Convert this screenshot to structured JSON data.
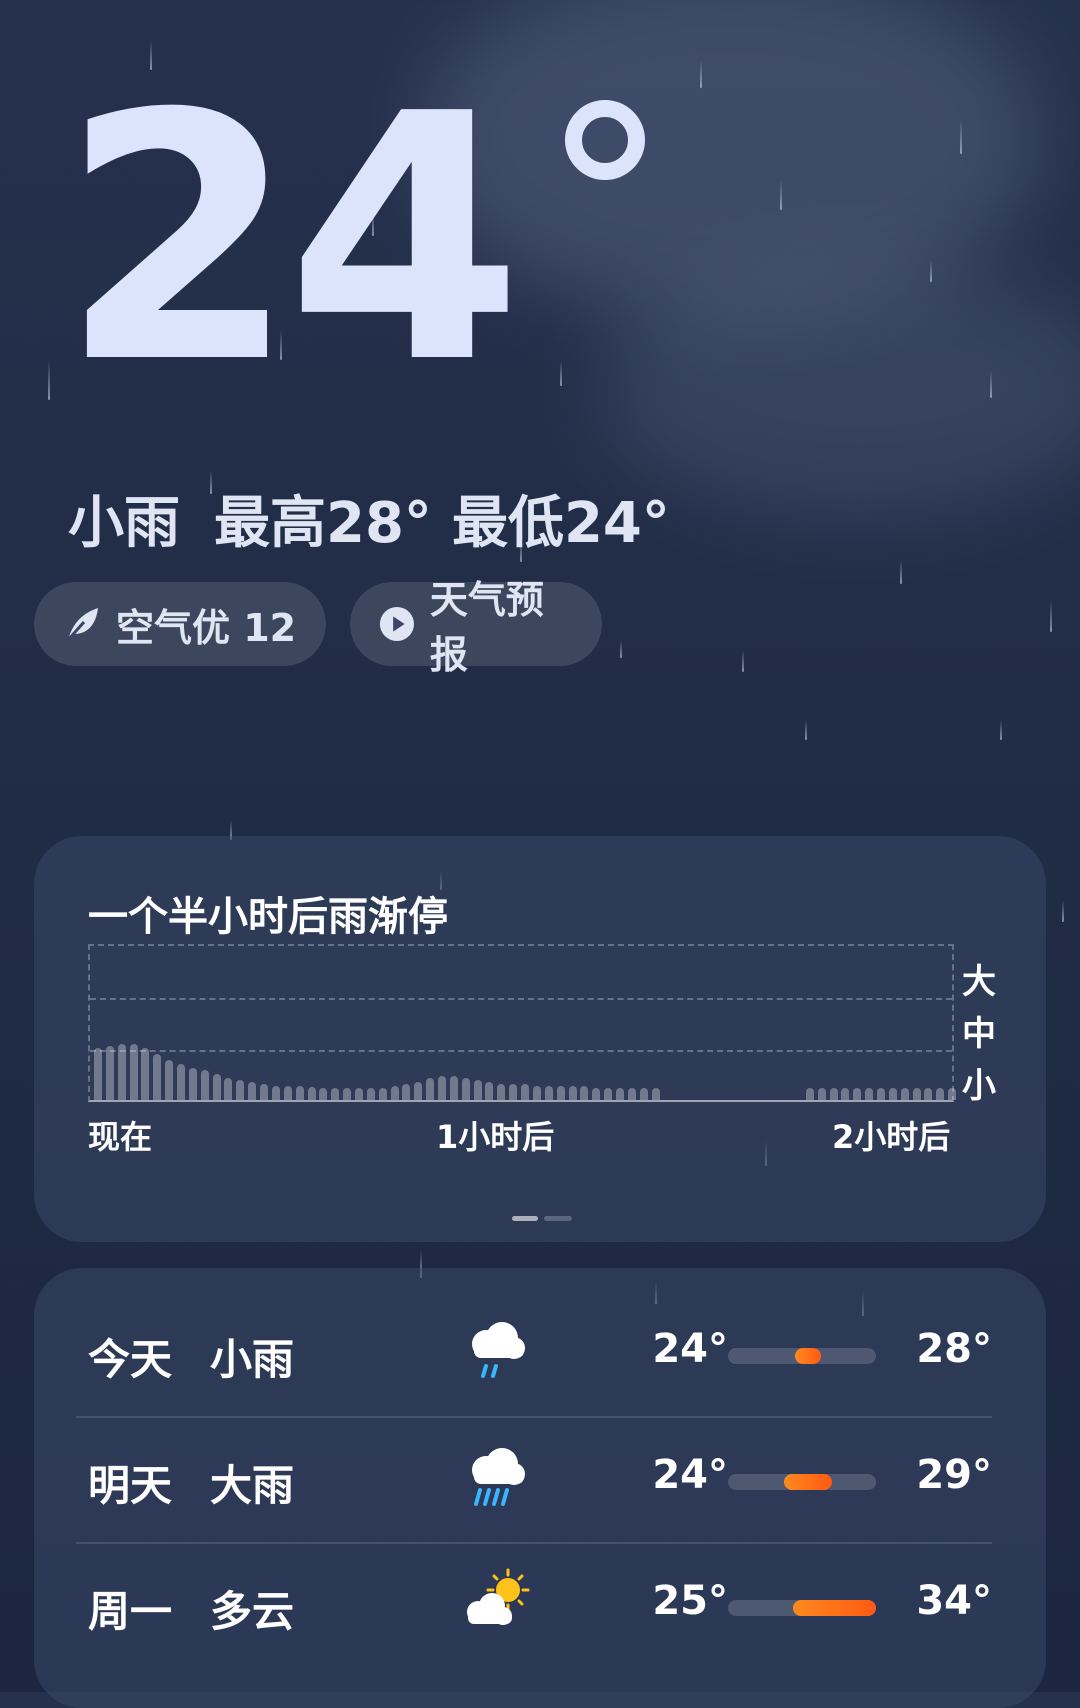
{
  "current": {
    "temperature": "24",
    "condition": "小雨",
    "high": "最高28°",
    "low": "最低24°"
  },
  "chips": {
    "air_quality": "空气优 12",
    "forecast_video": "天气预报"
  },
  "precip_card": {
    "title": "一个半小时后雨渐停",
    "y_labels": [
      "大",
      "中",
      "小"
    ],
    "x_labels": [
      "现在",
      "1小时后",
      "2小时后"
    ]
  },
  "forecast": [
    {
      "day": "今天",
      "condition": "小雨",
      "icon": "light-rain-icon",
      "low": "24°",
      "high": "28°",
      "bar_start": 0.45,
      "bar_end": 0.63
    },
    {
      "day": "明天",
      "condition": "大雨",
      "icon": "heavy-rain-icon",
      "low": "24°",
      "high": "29°",
      "bar_start": 0.38,
      "bar_end": 0.7
    },
    {
      "day": "周一",
      "condition": "多云",
      "icon": "partly-cloudy-icon",
      "low": "25°",
      "high": "34°",
      "bar_start": 0.44,
      "bar_end": 1.0
    }
  ],
  "colors": {
    "temp_range_start": "#ff8a1e",
    "temp_range_end": "#ff5a12",
    "rain_drops": "#38b6ff",
    "sun": "#ffc21a"
  }
}
